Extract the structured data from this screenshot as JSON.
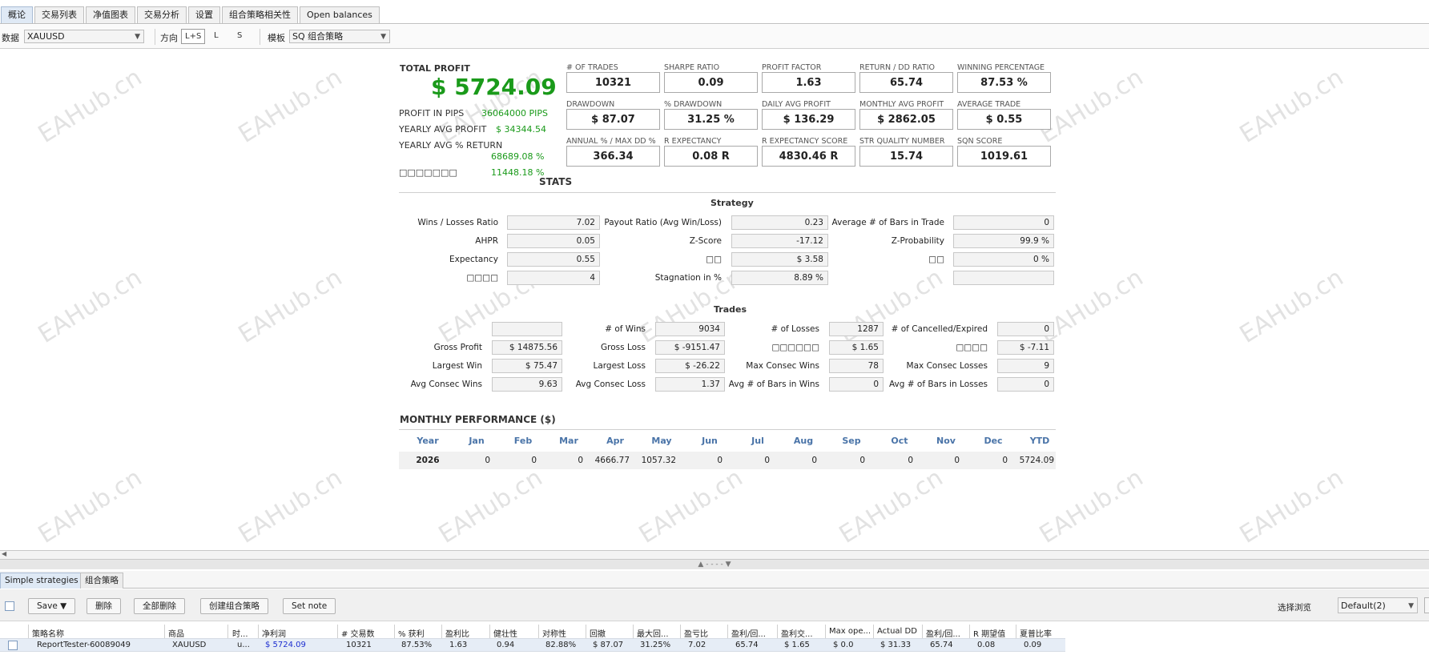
{
  "tabs": [
    "概论",
    "交易列表",
    "净值图表",
    "交易分析",
    "设置",
    "组合策略相关性",
    "Open balances"
  ],
  "toolbar": {
    "data_label": "数据",
    "data_value": "XAUUSD",
    "direction_label": "方向",
    "dir_options": [
      "L+S",
      "L",
      "S"
    ],
    "template_label": "模板",
    "template_value": "SQ 组合策略"
  },
  "watermark": "EAHub.cn",
  "summary": {
    "total_profit_label": "TOTAL PROFIT",
    "total_profit": "$ 5724.09",
    "rows": [
      {
        "label": "PROFIT IN PIPS",
        "value": "36064000 PIPS"
      },
      {
        "label": "YEARLY AVG PROFIT",
        "value": "$ 34344.54"
      },
      {
        "label": "YEARLY AVG % RETURN",
        "value": "68689.08 %"
      },
      {
        "label": "□□□□□□□",
        "value": "11448.18 %"
      }
    ]
  },
  "metrics": [
    {
      "label": "# OF TRADES",
      "value": "10321"
    },
    {
      "label": "SHARPE RATIO",
      "value": "0.09"
    },
    {
      "label": "PROFIT FACTOR",
      "value": "1.63"
    },
    {
      "label": "RETURN / DD RATIO",
      "value": "65.74"
    },
    {
      "label": "WINNING PERCENTAGE",
      "value": "87.53 %"
    },
    {
      "label": "DRAWDOWN",
      "value": "$ 87.07"
    },
    {
      "label": "% DRAWDOWN",
      "value": "31.25 %"
    },
    {
      "label": "DAILY AVG PROFIT",
      "value": "$ 136.29"
    },
    {
      "label": "MONTHLY AVG PROFIT",
      "value": "$ 2862.05"
    },
    {
      "label": "AVERAGE TRADE",
      "value": "$ 0.55"
    },
    {
      "label": "ANNUAL % / MAX DD %",
      "value": "366.34"
    },
    {
      "label": "R EXPECTANCY",
      "value": "0.08 R"
    },
    {
      "label": "R EXPECTANCY SCORE",
      "value": "4830.46 R"
    },
    {
      "label": "STR QUALITY NUMBER",
      "value": "15.74"
    },
    {
      "label": "SQN SCORE",
      "value": "1019.61"
    }
  ],
  "stats": {
    "title": "STATS",
    "strategy_title": "Strategy",
    "strategy": [
      {
        "label": "Wins / Losses Ratio",
        "value": "7.02"
      },
      {
        "label": "Payout Ratio (Avg Win/Loss)",
        "value": "0.23"
      },
      {
        "label": "Average # of Bars in Trade",
        "value": "0"
      },
      {
        "label": "AHPR",
        "value": "0.05"
      },
      {
        "label": "Z-Score",
        "value": "-17.12"
      },
      {
        "label": "Z-Probability",
        "value": "99.9 %"
      },
      {
        "label": "Expectancy",
        "value": "0.55"
      },
      {
        "label": "□□",
        "value": "$ 3.58"
      },
      {
        "label": "□□",
        "value": "0 %"
      },
      {
        "label": "□□□□",
        "value": "4"
      },
      {
        "label": "Stagnation in %",
        "value": "8.89 %"
      },
      {
        "label": "",
        "value": ""
      }
    ],
    "trades_title": "Trades",
    "trades": [
      {
        "label": "",
        "value": ""
      },
      {
        "label": "# of Wins",
        "value": "9034"
      },
      {
        "label": "# of Losses",
        "value": "1287"
      },
      {
        "label": "# of Cancelled/Expired",
        "value": "0"
      },
      {
        "label": "Gross Profit",
        "value": "$ 14875.56"
      },
      {
        "label": "Gross Loss",
        "value": "$ -9151.47"
      },
      {
        "label": "□□□□□□",
        "value": "$ 1.65"
      },
      {
        "label": "□□□□",
        "value": "$ -7.11"
      },
      {
        "label": "Largest Win",
        "value": "$ 75.47"
      },
      {
        "label": "Largest Loss",
        "value": "$ -26.22"
      },
      {
        "label": "Max Consec Wins",
        "value": "78"
      },
      {
        "label": "Max Consec Losses",
        "value": "9"
      },
      {
        "label": "Avg Consec Wins",
        "value": "9.63"
      },
      {
        "label": "Avg Consec Loss",
        "value": "1.37"
      },
      {
        "label": "Avg # of Bars in Wins",
        "value": "0"
      },
      {
        "label": "Avg # of Bars in Losses",
        "value": "0"
      }
    ]
  },
  "monthly": {
    "title": "MONTHLY PERFORMANCE ($)",
    "headers": [
      "Year",
      "Jan",
      "Feb",
      "Mar",
      "Apr",
      "May",
      "Jun",
      "Jul",
      "Aug",
      "Sep",
      "Oct",
      "Nov",
      "Dec",
      "YTD"
    ],
    "row": [
      "2026",
      "0",
      "0",
      "0",
      "4666.77",
      "1057.32",
      "0",
      "0",
      "0",
      "0",
      "0",
      "0",
      "0",
      "5724.09"
    ]
  },
  "splitter_text": "▲ - - - - ▼",
  "bottom_tabs": [
    "Simple strategies",
    "组合策略"
  ],
  "bottom_toolbar": {
    "buttons": [
      "Save ▼",
      "删除",
      "全部删除",
      "创建组合策略",
      "Set note"
    ],
    "view_label": "选择浏览",
    "view_value": "Default(2)"
  },
  "grid": {
    "headers": [
      "策略名称",
      "商品",
      "时...",
      "净利润",
      "# 交易数",
      "% 获利",
      "盈利比",
      "健壮性",
      "对称性",
      "回撤",
      "最大回...",
      "盈亏比",
      "盈利/回...",
      "盈利交...",
      "Max ope...",
      "Actual DD",
      "盈利/回...",
      "R 期望值",
      "夏普比率"
    ],
    "row": [
      "ReportTester-60089049",
      "XAUUSD",
      "u...",
      "$ 5724.09",
      "10321",
      "87.53%",
      "1.63",
      "0.94",
      "82.88%",
      "$ 87.07",
      "31.25%",
      "7.02",
      "65.74",
      "$ 1.65",
      "$ 0.0",
      "$ 31.33",
      "65.74",
      "0.08",
      "0.09"
    ]
  }
}
